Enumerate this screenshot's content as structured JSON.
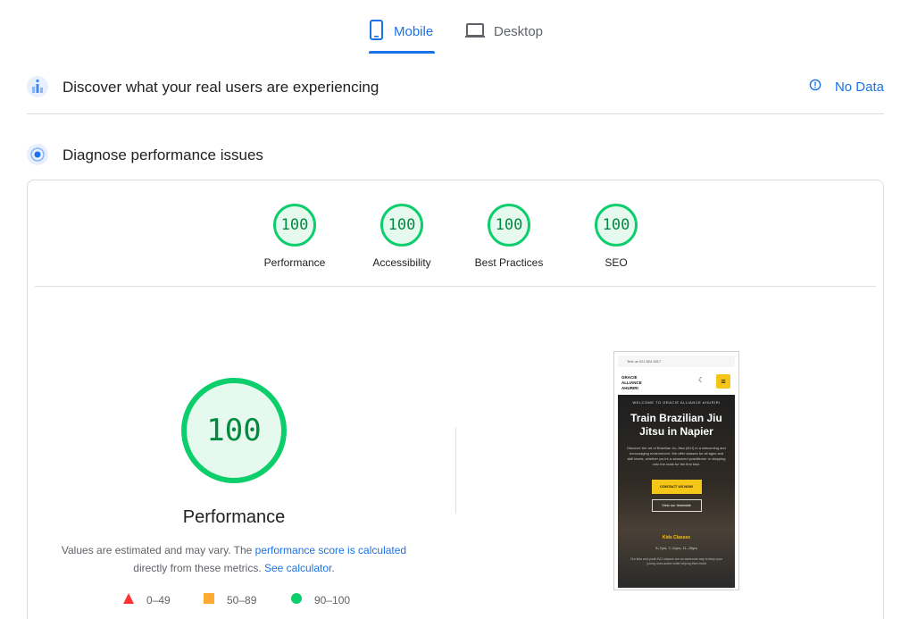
{
  "tabs": [
    {
      "label": "Mobile",
      "icon": "smartphone-icon",
      "active": true
    },
    {
      "label": "Desktop",
      "icon": "laptop-icon",
      "active": false
    }
  ],
  "field_data": {
    "title": "Discover what your real users are experiencing",
    "status": "No Data",
    "icon": "field-data-icon"
  },
  "lab_data": {
    "title": "Diagnose performance issues",
    "icon": "lab-data-icon"
  },
  "scores": [
    {
      "label": "Performance",
      "value": "100"
    },
    {
      "label": "Accessibility",
      "value": "100"
    },
    {
      "label": "Best Practices",
      "value": "100"
    },
    {
      "label": "SEO",
      "value": "100"
    }
  ],
  "performance": {
    "score": "100",
    "title": "Performance",
    "note_prefix": "Values are estimated and may vary. The ",
    "note_link1": "performance score is calculated",
    "note_middle": "directly from these metrics. ",
    "note_link2": "See calculator",
    "note_suffix": "."
  },
  "legend": [
    {
      "range": "0–49",
      "color": "#ff3333",
      "shape": "triangle"
    },
    {
      "range": "50–89",
      "color": "#ffaa33",
      "shape": "square"
    },
    {
      "range": "90–100",
      "color": "#0cce6b",
      "shape": "circle"
    }
  ],
  "colors": {
    "accent": "#1a73e8",
    "pass": "#0cce6b",
    "pass_text": "#008a3e",
    "pass_bg": "#e6f9ee"
  },
  "screenshot": {
    "top_bar": "Text us 021 824 4517",
    "logo": "GRACIE ALLIANCE AHURIRI",
    "welcome": "WELCOME TO GRACIE ALLIANCE AHURIRI",
    "heading": "Train Brazilian Jiu Jitsu in Napier",
    "paragraph": "Discover the art of Brazilian Jiu-Jitsu (BJJ) in a welcoming and encouraging environment. We offer classes for all ages and skill levels, whether you're a seasoned practitioner or stepping onto the mats for the first time.",
    "cta": "CONTACT US NOW",
    "timetable": "View our timetable",
    "kids": "Kids Classes",
    "ages": "5–7yrs, 7–11yrs, 11–15yrs",
    "footer": "Our kids and youth BJJ classes are an awesome way to keep your young ones active while helping them build"
  }
}
